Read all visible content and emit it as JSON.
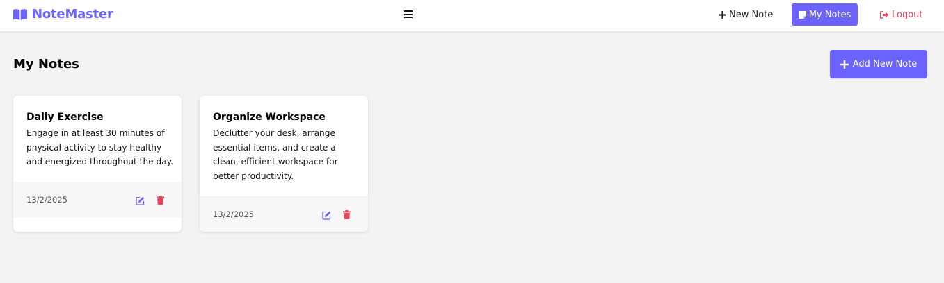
{
  "app": {
    "brand": "NoteMaster",
    "brand_icon": "book-icon",
    "accent": "#6c63ff",
    "danger": "#e8455b"
  },
  "nav": {
    "new_note_label": "New Note",
    "my_notes_label": "My Notes",
    "logout_label": "Logout"
  },
  "main": {
    "title": "My Notes",
    "add_button_label": "Add New Note"
  },
  "notes": [
    {
      "title": "Daily Exercise",
      "body": "Engage in at least 30 minutes of physical activity to stay healthy and energized throughout the day.",
      "date": "13/2/2025"
    },
    {
      "title": "Organize Workspace",
      "body": "Declutter your desk, arrange essential items, and create a clean, efficient workspace for better productivity.",
      "date": "13/2/2025"
    }
  ]
}
